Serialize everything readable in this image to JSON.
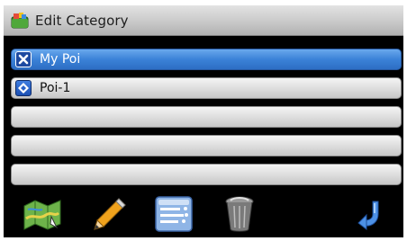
{
  "window": {
    "title": "Edit Category",
    "title_icon": "category-folder-icon"
  },
  "categories": [
    {
      "label": "My Poi",
      "icon": "delete-x-icon",
      "selected": true
    },
    {
      "label": "Poi-1",
      "icon": "poi-diamond-icon",
      "selected": false
    },
    {
      "label": "",
      "icon": "",
      "selected": false
    },
    {
      "label": "",
      "icon": "",
      "selected": false
    },
    {
      "label": "",
      "icon": "",
      "selected": false
    }
  ],
  "toolbar": {
    "buttons": [
      {
        "name": "map-icon"
      },
      {
        "name": "pencil-icon"
      },
      {
        "name": "list-icon"
      },
      {
        "name": "trash-icon"
      },
      {
        "name": "back-arrow-icon"
      }
    ]
  },
  "colors": {
    "selected_row": "#3b82d8",
    "row": "#dcdcdc",
    "background": "#000000"
  }
}
